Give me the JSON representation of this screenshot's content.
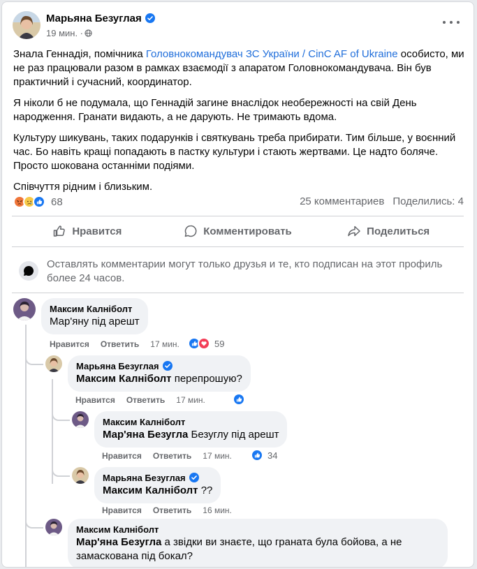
{
  "post": {
    "author": "Марьяна Безуглая",
    "time": "19 мин. ·",
    "link_text": "Головнокомандувач ЗС України / CinC AF of Ukraine",
    "p1_before": "Знала Геннадія, помічника ",
    "p1_after": " особисто, ми не раз працювали разом в рамках взаємодії з апаратом Головнокомандувача. Він був практичний і сучасний, координатор.",
    "p2": "Я ніколи б не подумала, що Геннадій загине внаслідок необережності на свій День народження. Гранати видають, а не дарують. Не тримають вдома.",
    "p3": "Культуру шикувань, таких подарунків і святкувань треба прибирати. Тим більше, у воєнний час. Бо навіть кращі попадають в пастку культури і стають жертвами. Це надто боляче. Просто шокована останніми подіями.",
    "p4": "Співчуття рідним і близьким.",
    "reaction_count": "68",
    "comments_count": "25 комментариев",
    "shares_count": "Поделились: 4"
  },
  "actions": {
    "like": "Нравится",
    "comment": "Комментировать",
    "share": "Поделиться"
  },
  "notice": "Оставлять комментарии могут только друзья и те, кто подписан на этот профиль более 24 часов.",
  "comment_labels": {
    "like": "Нравится",
    "reply": "Ответить"
  },
  "comments": [
    {
      "author": "Максим Калнiболт",
      "text": "Мар'яну під арешт",
      "time": "17 мин.",
      "reactions": "59"
    },
    {
      "author": "Марьяна Безуглая",
      "mention": "Максим Калнiболт",
      "text": " перепрошую?",
      "time": "17 мин."
    },
    {
      "author": "Максим Калнiболт",
      "mention": "Мар'яна Безугла",
      "text": " Безуглу під арешт",
      "time": "17 мин.",
      "reactions": "34"
    },
    {
      "author": "Марьяна Безуглая",
      "mention": "Максим Калнiболт",
      "text": " ??",
      "time": "16 мин."
    },
    {
      "author": "Максим Калнiболт",
      "mention": "Мар'яна Безугла",
      "text": " а звідки ви знаєте, що граната була бойова, а не замаскована під бокал?"
    }
  ],
  "colors": {
    "link": "#216fdb",
    "like_blue": "#1877f2",
    "love_red": "#f33e58",
    "muted": "#65676b",
    "bubble": "#f0f2f5"
  },
  "icons": [
    "verified-icon",
    "globe-icon",
    "more-icon",
    "like-icon",
    "comment-icon",
    "share-icon",
    "chat-bubble-icon",
    "angry-reaction-icon",
    "sad-reaction-icon",
    "like-reaction-icon",
    "love-reaction-icon"
  ]
}
